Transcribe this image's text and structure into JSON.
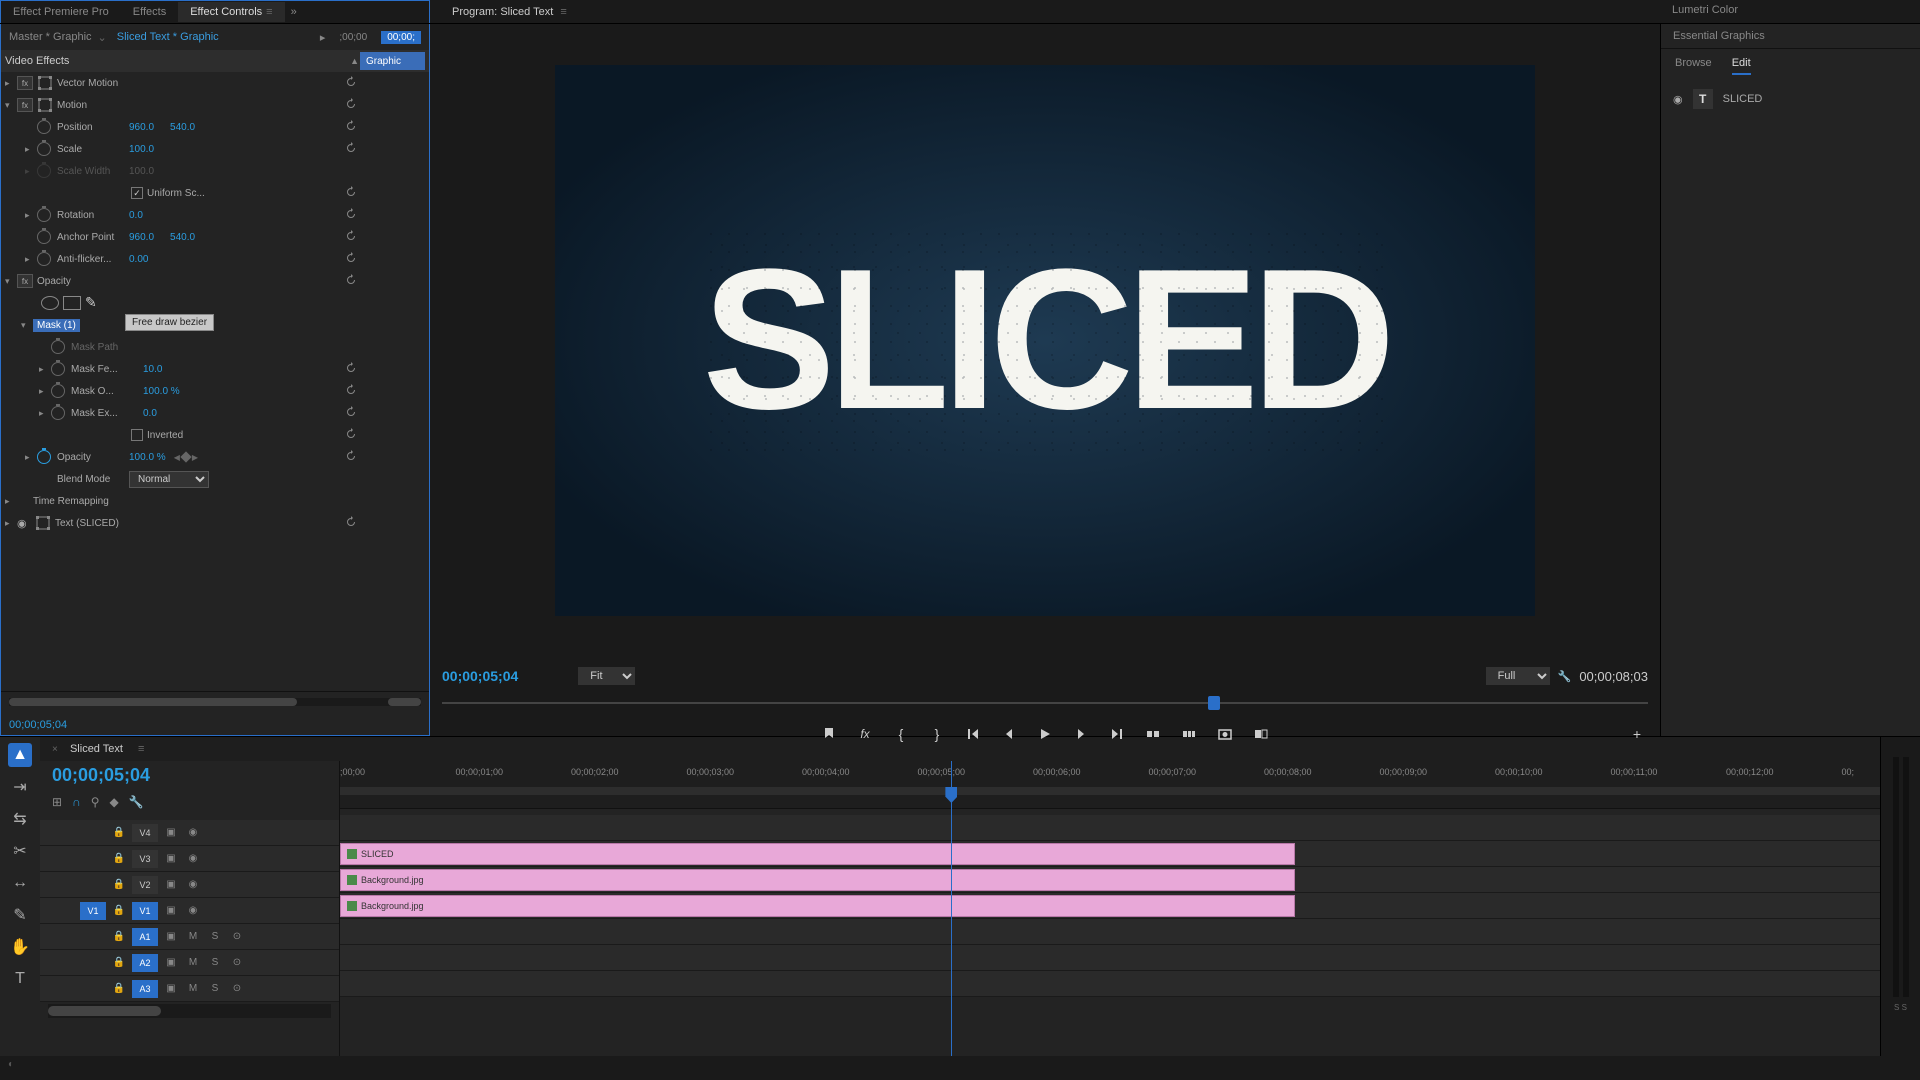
{
  "tabs": {
    "effect_pro": "Effect Premiere Pro",
    "effects": "Effects",
    "effect_controls": "Effect Controls"
  },
  "program": {
    "label": "Program:",
    "name": "Sliced Text"
  },
  "lumetri": "Lumetri Color",
  "essential_graphics": "Essential Graphics",
  "eg": {
    "browse": "Browse",
    "edit": "Edit",
    "layer": "SLICED"
  },
  "ec": {
    "master": "Master * Graphic",
    "selected": "Sliced Text * Graphic",
    "t0": ";00;00",
    "t1": "00;00;",
    "graphic_badge": "Graphic",
    "video_effects": "Video Effects",
    "vector_motion": "Vector Motion",
    "motion": "Motion",
    "position": "Position",
    "pos_x": "960.0",
    "pos_y": "540.0",
    "scale": "Scale",
    "scale_v": "100.0",
    "scale_width": "Scale Width",
    "scale_width_v": "100.0",
    "uniform": "Uniform Sc...",
    "rotation": "Rotation",
    "rotation_v": "0.0",
    "anchor": "Anchor Point",
    "anchor_x": "960.0",
    "anchor_y": "540.0",
    "antiflicker": "Anti-flicker...",
    "antiflicker_v": "0.00",
    "opacity": "Opacity",
    "mask1": "Mask (1)",
    "tooltip": "Free draw bezier",
    "mask_path": "Mask Path",
    "mask_feather": "Mask Fe...",
    "mask_feather_v": "10.0",
    "mask_opacity": "Mask O...",
    "mask_opacity_v": "100.0 %",
    "mask_expansion": "Mask Ex...",
    "mask_expansion_v": "0.0",
    "inverted": "Inverted",
    "opacity_prop": "Opacity",
    "opacity_v": "100.0 %",
    "blend": "Blend Mode",
    "blend_v": "Normal",
    "time_remap": "Time Remapping",
    "text_sliced": "Text (SLICED)",
    "footer_time": "00;00;05;04"
  },
  "monitor": {
    "text": "SLICED",
    "time": "00;00;05;04",
    "fit": "Fit",
    "resolution": "Full",
    "duration": "00;00;08;03"
  },
  "timeline": {
    "seq": "Sliced Text",
    "time": "00;00;05;04",
    "ticks": [
      ";00;00",
      "00;00;01;00",
      "00;00;02;00",
      "00;00;03;00",
      "00;00;04;00",
      "00;00;05;00",
      "00;00;06;00",
      "00;00;07;00",
      "00;00;08;00",
      "00;00;09;00",
      "00;00;10;00",
      "00;00;11;00",
      "00;00;12;00",
      "00;"
    ],
    "v4": "V4",
    "v3": "V3",
    "v2": "V2",
    "v1": "V1",
    "a1": "A1",
    "a2": "A2",
    "a3": "A3",
    "m": "M",
    "s": "S",
    "clip_sliced": "SLICED",
    "clip_bg": "Background.jpg"
  },
  "meter": {
    "label": "S  S"
  }
}
